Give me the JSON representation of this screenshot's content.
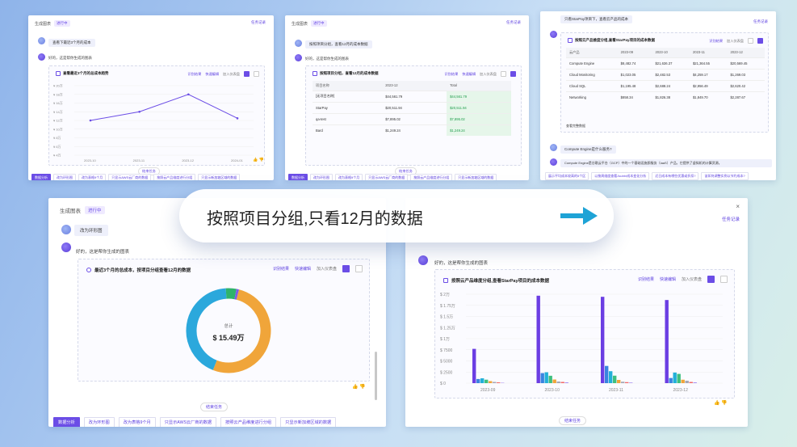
{
  "common": {
    "panel_title": "生成图表",
    "status_tag": "进行中",
    "task_log": "任务记录",
    "bot_reply": "好的，这是帮你生成的图表",
    "toolbar": {
      "recognize": "识别结果",
      "quick_edit": "快速编辑",
      "add_dashboard": "加入仪表盘"
    },
    "end_task": "结束任务",
    "suggestions": [
      "数据分析",
      "改为环形图",
      "改为表格9个月",
      "只显示AWS云厂商的数据",
      "按照云产品维度进行分组",
      "只显示新加坡区域的数据"
    ],
    "thumbs": "👍 👎"
  },
  "card1": {
    "user_msg": "查看下最近3个月的成本",
    "chart_title": "查看最近3个月的总成本趋势",
    "chart_data": {
      "type": "line",
      "x": [
        "2023-10",
        "2023-11",
        "2023-12",
        "2024-01"
      ],
      "series": [
        {
          "values": [
            120,
            140,
            180,
            125
          ]
        }
      ],
      "yticks": [
        "¥ 20万",
        "¥ 18万",
        "¥ 16万",
        "¥ 14万",
        "¥ 12万",
        "¥ 10万",
        "¥ 8万",
        "¥ 6万",
        "¥ 4万"
      ]
    }
  },
  "card2": {
    "user_msg": "按照项目分组，查看12月的成本数据",
    "chart_title": "按照项目分组，查看12月的成本数据",
    "table": {
      "headers": [
        "项目名称",
        "2023-12",
        "Total"
      ],
      "rows": [
        [
          "[无项目名称]",
          "$44,561.79",
          "$44,561.79"
        ],
        [
          "StarPay",
          "$20,511.94",
          "$20,511.94"
        ],
        [
          "qa-test",
          "$7,895.02",
          "$7,895.02"
        ],
        [
          "Bard",
          "$1,249.24",
          "$1,249.24"
        ]
      ]
    }
  },
  "card3": {
    "user_msg": "只看StarPay项目下，查看云产品的成本",
    "chart_title": "按照云产品维度分组,查看StarPay项目的成本数据",
    "table": {
      "headers": [
        "云产品",
        "2023-09",
        "2023-10",
        "2023-11",
        "2023-12"
      ],
      "rows": [
        [
          "Compute Engine",
          "$8,482.74",
          "$21,636.37",
          "$21,364.55",
          "$20,569.45"
        ],
        [
          "Cloud Monitoring",
          "$1,023.05",
          "$2,482.53",
          "$4,259.17",
          "$1,269.03"
        ],
        [
          "Cloud SQL",
          "$1,195.48",
          "$2,688.24",
          "$2,956.49",
          "$2,620.42"
        ],
        [
          "Networking",
          "$858.34",
          "$1,826.38",
          "$1,849.70",
          "$2,287.67"
        ]
      ]
    },
    "more": "查看完整数据",
    "user_q": "Compute Engine是什么服务?",
    "answer": "Compute Engine是谷歌云平台（GCP）中的一个基础设施即服务（IaaS）产品，它提供了虚拟机的计算资源。",
    "suggestions": [
      "展示平均成本较高的5个区",
      "以按周维度查看Jsubbr成本变化分析",
      "近日成本有哪些优惠或折扣?",
      "该如何调整实例以节约成本?"
    ]
  },
  "card4": {
    "user_msg": "改为环形图",
    "chart_title": "最近3个月的总成本，按项目分组查看12月的数据",
    "donut_label": "总计",
    "donut_value": "$ 15.49万",
    "chart_data": {
      "type": "pie",
      "slices": [
        {
          "label": "[无项目名称]",
          "value": 0.52,
          "color": "#f0a53a"
        },
        {
          "label": "StarPay",
          "value": 0.43,
          "color": "#2ba8dc"
        },
        {
          "label": "qa-test",
          "value": 0.04,
          "color": "#2fb36b"
        },
        {
          "label": "Bard",
          "value": 0.01,
          "color": "#7c5ce6"
        }
      ]
    }
  },
  "card5": {
    "chart_title": "按照云产品维度分组,查看StarPay项目的成本数据",
    "chart_data": {
      "type": "bar",
      "categories": [
        "2023-09",
        "2023-10",
        "2023-11",
        "2023-12"
      ],
      "yticks": [
        "$ 2万",
        "$ 1.75万",
        "$ 1.5万",
        "$ 1.25万",
        "$ 1万",
        "$ 7500",
        "$ 5000",
        "$ 2500",
        "$ 0"
      ],
      "series": [
        {
          "values": [
            8482,
            21636,
            21364,
            20569
          ],
          "color": "#6b3ee3"
        },
        {
          "values": [
            1023,
            2482,
            4259,
            1269
          ],
          "color": "#3a84e0"
        },
        {
          "values": [
            1195,
            2688,
            2956,
            2620
          ],
          "color": "#22b0d8"
        },
        {
          "values": [
            858,
            1826,
            1849,
            2287
          ],
          "color": "#3fbf7f"
        },
        {
          "values": [
            500,
            900,
            800,
            850
          ],
          "color": "#f0a53a"
        },
        {
          "values": [
            300,
            400,
            350,
            600
          ],
          "color": "#a5a7b5"
        },
        {
          "values": [
            200,
            300,
            250,
            300
          ],
          "color": "#f26a6a"
        },
        {
          "values": [
            100,
            200,
            150,
            200
          ],
          "color": "#a88ff0"
        }
      ]
    }
  },
  "pill": {
    "text": "按照项目分组,只看12月的数据"
  }
}
